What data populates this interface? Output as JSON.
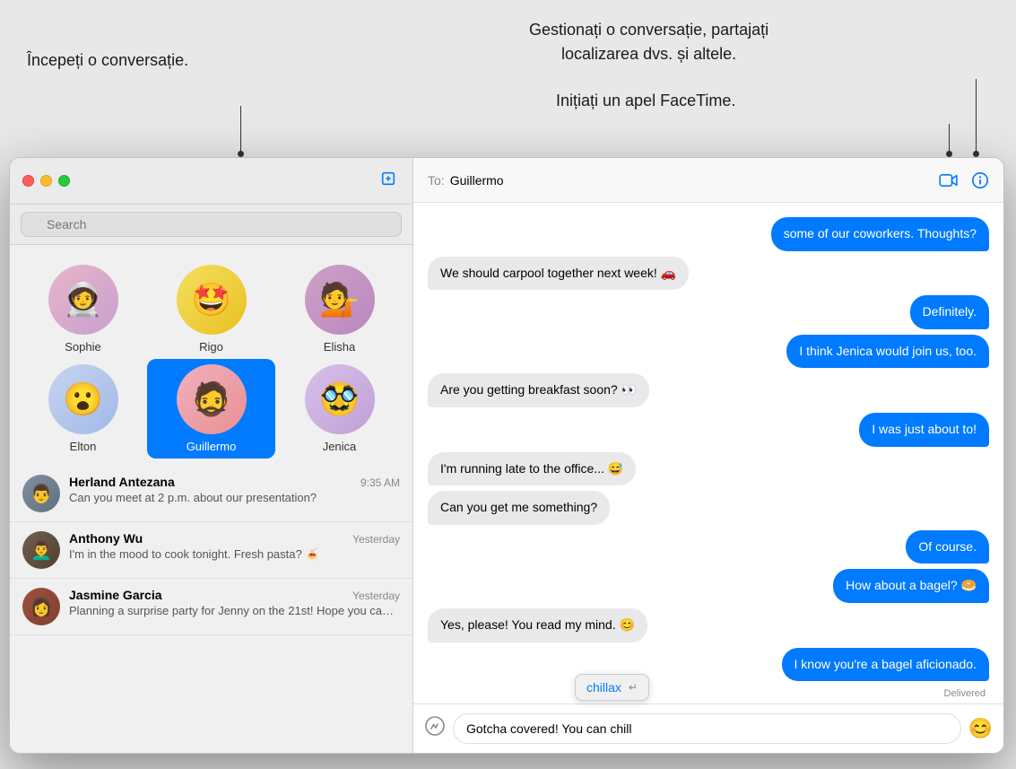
{
  "annotations": {
    "compose": "Începeți o conversație.",
    "manage": "Gestionați o conversație, partajați\nlocalizarea dvs. și altele.",
    "facetime": "Inițiați un apel FaceTime."
  },
  "window": {
    "title": "Messages"
  },
  "sidebar": {
    "search_placeholder": "Search",
    "compose_icon": "✎",
    "pinned": [
      {
        "name": "Sophie",
        "emoji": "🧑‍🚀",
        "avatar_class": "avatar-sophie"
      },
      {
        "name": "Rigo",
        "emoji": "🤩",
        "avatar_class": "avatar-rigo"
      },
      {
        "name": "Elisha",
        "emoji": "💁",
        "avatar_class": "avatar-elisha"
      },
      {
        "name": "Elton",
        "emoji": "😮",
        "avatar_class": "avatar-elton"
      },
      {
        "name": "Guillermo",
        "emoji": "🧔",
        "avatar_class": "avatar-guillermo",
        "selected": true
      },
      {
        "name": "Jenica",
        "emoji": "🥸",
        "avatar_class": "avatar-jenica"
      }
    ],
    "conversations": [
      {
        "name": "Herland Antezana",
        "time": "9:35 AM",
        "preview": "Can you meet at 2 p.m. about our presentation?",
        "avatar_class": "convo-herland",
        "emoji": "👨"
      },
      {
        "name": "Anthony Wu",
        "time": "Yesterday",
        "preview": "I'm in the mood to cook tonight. Fresh pasta? 🍝",
        "avatar_class": "convo-anthony",
        "emoji": "👨‍🦱"
      },
      {
        "name": "Jasmine Garcia",
        "time": "Yesterday",
        "preview": "Planning a surprise party for Jenny on the 21st! Hope you can make it.",
        "avatar_class": "convo-jasmine",
        "emoji": "👩"
      }
    ]
  },
  "chat": {
    "to_label": "To:",
    "recipient": "Guillermo",
    "messages": [
      {
        "type": "sent",
        "text": "some of our coworkers. Thoughts?"
      },
      {
        "type": "received",
        "text": "We should carpool together next week! 🚗"
      },
      {
        "type": "sent",
        "text": "Definitely."
      },
      {
        "type": "sent",
        "text": "I think Jenica would join us, too."
      },
      {
        "type": "received",
        "text": "Are you getting breakfast soon? 👀"
      },
      {
        "type": "sent",
        "text": "I was just about to!"
      },
      {
        "type": "received",
        "text": "I'm running late to the office... 😅"
      },
      {
        "type": "received",
        "text": "Can you get me something?"
      },
      {
        "type": "sent",
        "text": "Of course."
      },
      {
        "type": "sent",
        "text": "How about a bagel? 🥯"
      },
      {
        "type": "received",
        "text": "Yes, please! You read my mind. 😊"
      },
      {
        "type": "sent",
        "text": "I know you're a bagel aficionado."
      }
    ],
    "delivered_label": "Delivered",
    "input_value": "Gotcha covered! You can chill",
    "autocomplete": "chillax ↵"
  }
}
